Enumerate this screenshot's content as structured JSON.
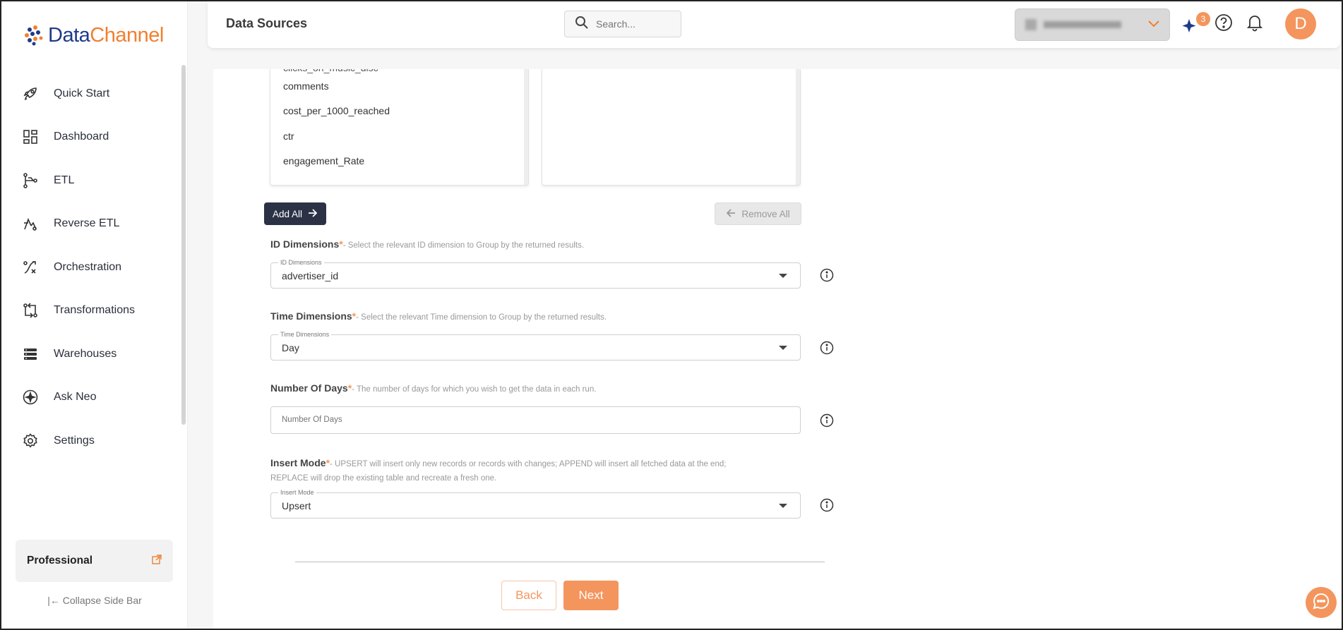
{
  "brand": {
    "name_part1": "Data",
    "name_part2": "Channel",
    "primary_color": "#1e3a8a",
    "accent_color": "#f08030"
  },
  "sidebar": {
    "items": [
      {
        "label": "Quick Start",
        "icon": "rocket-icon"
      },
      {
        "label": "Dashboard",
        "icon": "dashboard-icon"
      },
      {
        "label": "ETL",
        "icon": "etl-icon"
      },
      {
        "label": "Reverse ETL",
        "icon": "reverse-etl-icon"
      },
      {
        "label": "Orchestration",
        "icon": "orchestration-icon"
      },
      {
        "label": "Transformations",
        "icon": "transformations-icon"
      },
      {
        "label": "Warehouses",
        "icon": "warehouses-icon"
      },
      {
        "label": "Ask Neo",
        "icon": "ask-neo-icon"
      },
      {
        "label": "Settings",
        "icon": "gear-icon"
      }
    ],
    "plan": "Professional",
    "collapse_label": "Collapse Side Bar"
  },
  "header": {
    "title": "Data Sources",
    "search_placeholder": "Search...",
    "notification_count": "3",
    "avatar_letter": "D"
  },
  "metrics_list": {
    "items": [
      "clicks_on_music_disc",
      "comments",
      "cost_per_1000_reached",
      "ctr",
      "engagement_Rate"
    ]
  },
  "buttons": {
    "add_all": "Add All",
    "remove_all": "Remove All",
    "back": "Back",
    "next": "Next"
  },
  "form": {
    "id_dimensions": {
      "label": "ID Dimensions",
      "required": "*",
      "hint": "- Select the relevant ID dimension to Group by the returned results.",
      "legend": "ID Dimensions",
      "value": "advertiser_id"
    },
    "time_dimensions": {
      "label": "Time Dimensions",
      "required": "*",
      "hint": "- Select the relevant Time dimension to Group by the returned results.",
      "legend": "Time Dimensions",
      "value": "Day"
    },
    "number_of_days": {
      "label": "Number Of Days",
      "required": "*",
      "hint": "- The number of days for which you wish to get the data in each run.",
      "placeholder": "Number Of Days"
    },
    "insert_mode": {
      "label": "Insert Mode",
      "required": "*",
      "hint": "- UPSERT will insert only new records or records with changes; APPEND will insert all fetched data at the end; REPLACE will drop the existing table and recreate a fresh one.",
      "legend": "Insert Mode",
      "value": "Upsert"
    }
  }
}
